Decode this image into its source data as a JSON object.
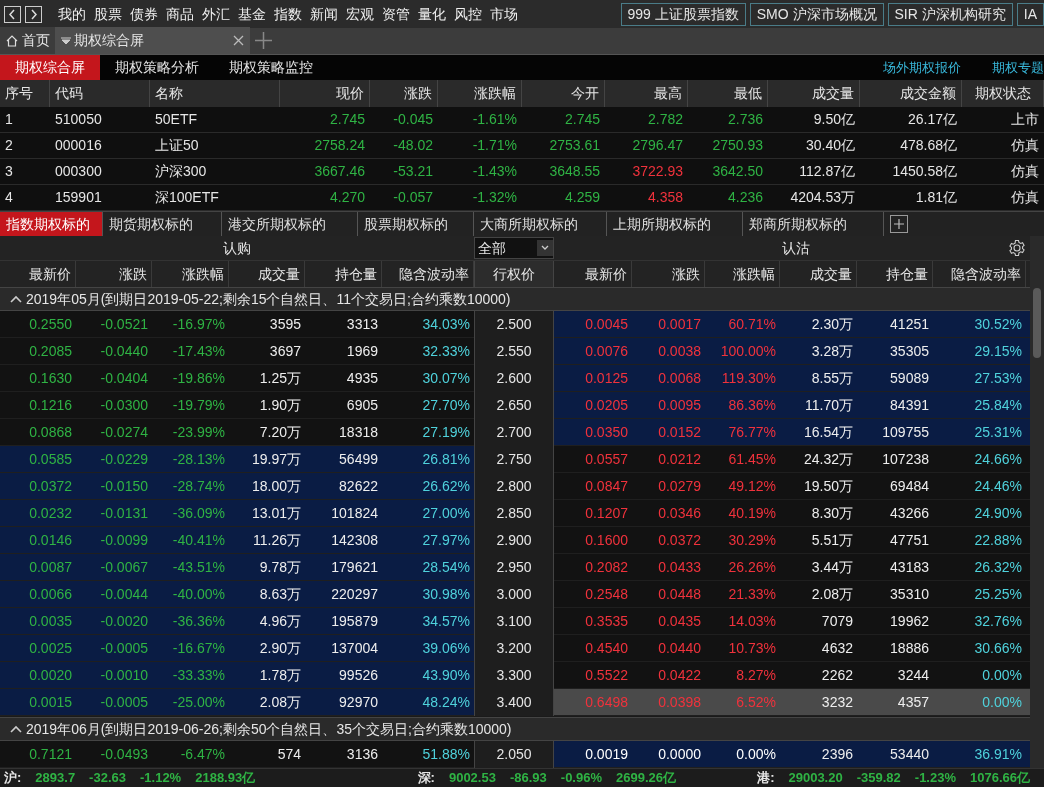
{
  "nav": {
    "items": [
      "我的",
      "股票",
      "债券",
      "商品",
      "外汇",
      "基金",
      "指数",
      "新闻",
      "宏观",
      "资管",
      "量化",
      "风控",
      "市场"
    ],
    "quick_links": [
      {
        "code": "999",
        "label": "上证股票指数"
      },
      {
        "code": "SMO",
        "label": "沪深市场概况"
      },
      {
        "code": "SIR",
        "label": "沪深机构研究"
      },
      {
        "code": "IA"
      }
    ]
  },
  "tabs": [
    {
      "label": "首页",
      "kind": "home",
      "selected": false
    },
    {
      "label": "期权综合屏",
      "kind": "page",
      "selected": true
    }
  ],
  "subnav": {
    "items": [
      {
        "label": "期权综合屏",
        "selected": true
      },
      {
        "label": "期权策略分析",
        "selected": false
      },
      {
        "label": "期权策略监控",
        "selected": false
      }
    ],
    "links": [
      "场外期权报价",
      "期权专题"
    ]
  },
  "underlying_table": {
    "columns": [
      "序号",
      "代码",
      "名称",
      "现价",
      "涨跌",
      "涨跌幅",
      "今开",
      "最高",
      "最低",
      "成交量",
      "成交金额",
      "期权状态"
    ],
    "rows": [
      {
        "cells": [
          {
            "text": "1"
          },
          {
            "text": "510050"
          },
          {
            "text": "50ETF"
          },
          {
            "text": "2.745",
            "color": "#2fb344"
          },
          {
            "text": "-0.045",
            "color": "#2fb344"
          },
          {
            "text": "-1.61%",
            "color": "#2fb344"
          },
          {
            "text": "2.745",
            "color": "#2fb344"
          },
          {
            "text": "2.782",
            "color": "#2fb344"
          },
          {
            "text": "2.736",
            "color": "#2fb344"
          },
          {
            "text": "9.50亿"
          },
          {
            "text": "26.17亿"
          },
          {
            "text": "上市"
          }
        ]
      },
      {
        "cells": [
          {
            "text": "2"
          },
          {
            "text": "000016"
          },
          {
            "text": "上证50"
          },
          {
            "text": "2758.24",
            "color": "#2fb344"
          },
          {
            "text": "-48.02",
            "color": "#2fb344"
          },
          {
            "text": "-1.71%",
            "color": "#2fb344"
          },
          {
            "text": "2753.61",
            "color": "#2fb344"
          },
          {
            "text": "2796.47",
            "color": "#2fb344"
          },
          {
            "text": "2750.93",
            "color": "#2fb344"
          },
          {
            "text": "30.40亿"
          },
          {
            "text": "478.68亿"
          },
          {
            "text": "仿真"
          }
        ]
      },
      {
        "cells": [
          {
            "text": "3"
          },
          {
            "text": "000300"
          },
          {
            "text": "沪深300"
          },
          {
            "text": "3667.46",
            "color": "#2fb344"
          },
          {
            "text": "-53.21",
            "color": "#2fb344"
          },
          {
            "text": "-1.43%",
            "color": "#2fb344"
          },
          {
            "text": "3648.55",
            "color": "#2fb344"
          },
          {
            "text": "3722.93",
            "color": "#f0323c"
          },
          {
            "text": "3642.50",
            "color": "#2fb344"
          },
          {
            "text": "112.87亿"
          },
          {
            "text": "1450.58亿"
          },
          {
            "text": "仿真"
          }
        ]
      },
      {
        "cells": [
          {
            "text": "4"
          },
          {
            "text": "159901"
          },
          {
            "text": "深100ETF"
          },
          {
            "text": "4.270",
            "color": "#2fb344"
          },
          {
            "text": "-0.057",
            "color": "#2fb344"
          },
          {
            "text": "-1.32%",
            "color": "#2fb344"
          },
          {
            "text": "4.259",
            "color": "#2fb344"
          },
          {
            "text": "4.358",
            "color": "#f0323c"
          },
          {
            "text": "4.236",
            "color": "#2fb344"
          },
          {
            "text": "4204.53万"
          },
          {
            "text": "1.81亿"
          },
          {
            "text": "仿真"
          }
        ]
      }
    ]
  },
  "category_tabs": [
    {
      "label": "指数期权标的",
      "selected": true
    },
    {
      "label": "期货期权标的",
      "selected": false
    },
    {
      "label": "港交所期权标的",
      "selected": false
    },
    {
      "label": "股票期权标的",
      "selected": false
    },
    {
      "label": "大商所期权标的",
      "selected": false
    },
    {
      "label": "上期所期权标的",
      "selected": false
    },
    {
      "label": "郑商所期权标的",
      "selected": false
    }
  ],
  "options": {
    "call_title": "认购",
    "put_title": "认沽",
    "filter": "全部",
    "call_columns": [
      "最新价",
      "涨跌",
      "涨跌幅",
      "成交量",
      "持仓量",
      "隐含波动率"
    ],
    "strike_column": "行权价",
    "put_columns": [
      "最新价",
      "涨跌",
      "涨跌幅",
      "成交量",
      "持仓量",
      "隐含波动率"
    ],
    "groups": [
      {
        "title": "2019年05月(到期日2019-05-22;剩余15个自然日、11个交易日;合约乘数10000)",
        "expanded": true,
        "rows": [
          {
            "strike": "2.500",
            "call_in_money": true,
            "selected": false,
            "call": {
              "color": "#2fb344",
              "cells": [
                "0.2550",
                "-0.0521",
                "-16.97%",
                "3595",
                "3313",
                "34.03%"
              ]
            },
            "put": {
              "color": "#f0323c",
              "cells": [
                "0.0045",
                "0.0017",
                "60.71%",
                "2.30万",
                "41251",
                "30.52%"
              ]
            }
          },
          {
            "strike": "2.550",
            "call_in_money": true,
            "selected": false,
            "call": {
              "color": "#2fb344",
              "cells": [
                "0.2085",
                "-0.0440",
                "-17.43%",
                "3697",
                "1969",
                "32.33%"
              ]
            },
            "put": {
              "color": "#f0323c",
              "cells": [
                "0.0076",
                "0.0038",
                "100.00%",
                "3.28万",
                "35305",
                "29.15%"
              ]
            }
          },
          {
            "strike": "2.600",
            "call_in_money": true,
            "selected": false,
            "call": {
              "color": "#2fb344",
              "cells": [
                "0.1630",
                "-0.0404",
                "-19.86%",
                "1.25万",
                "4935",
                "30.07%"
              ]
            },
            "put": {
              "color": "#f0323c",
              "cells": [
                "0.0125",
                "0.0068",
                "119.30%",
                "8.55万",
                "59089",
                "27.53%"
              ]
            }
          },
          {
            "strike": "2.650",
            "call_in_money": true,
            "selected": false,
            "call": {
              "color": "#2fb344",
              "cells": [
                "0.1216",
                "-0.0300",
                "-19.79%",
                "1.90万",
                "6905",
                "27.70%"
              ]
            },
            "put": {
              "color": "#f0323c",
              "cells": [
                "0.0205",
                "0.0095",
                "86.36%",
                "11.70万",
                "84391",
                "25.84%"
              ]
            }
          },
          {
            "strike": "2.700",
            "call_in_money": true,
            "selected": false,
            "call": {
              "color": "#2fb344",
              "cells": [
                "0.0868",
                "-0.0274",
                "-23.99%",
                "7.20万",
                "18318",
                "27.19%"
              ]
            },
            "put": {
              "color": "#f0323c",
              "cells": [
                "0.0350",
                "0.0152",
                "76.77%",
                "16.54万",
                "109755",
                "25.31%"
              ]
            }
          },
          {
            "strike": "2.750",
            "call_in_money": false,
            "selected": false,
            "call": {
              "color": "#2fb344",
              "cells": [
                "0.0585",
                "-0.0229",
                "-28.13%",
                "19.97万",
                "56499",
                "26.81%"
              ]
            },
            "put": {
              "color": "#f0323c",
              "cells": [
                "0.0557",
                "0.0212",
                "61.45%",
                "24.32万",
                "107238",
                "24.66%"
              ]
            }
          },
          {
            "strike": "2.800",
            "call_in_money": false,
            "selected": false,
            "call": {
              "color": "#2fb344",
              "cells": [
                "0.0372",
                "-0.0150",
                "-28.74%",
                "18.00万",
                "82622",
                "26.62%"
              ]
            },
            "put": {
              "color": "#f0323c",
              "cells": [
                "0.0847",
                "0.0279",
                "49.12%",
                "19.50万",
                "69484",
                "24.46%"
              ]
            }
          },
          {
            "strike": "2.850",
            "call_in_money": false,
            "selected": false,
            "call": {
              "color": "#2fb344",
              "cells": [
                "0.0232",
                "-0.0131",
                "-36.09%",
                "13.01万",
                "101824",
                "27.00%"
              ]
            },
            "put": {
              "color": "#f0323c",
              "cells": [
                "0.1207",
                "0.0346",
                "40.19%",
                "8.30万",
                "43266",
                "24.90%"
              ]
            }
          },
          {
            "strike": "2.900",
            "call_in_money": false,
            "selected": false,
            "call": {
              "color": "#2fb344",
              "cells": [
                "0.0146",
                "-0.0099",
                "-40.41%",
                "11.26万",
                "142308",
                "27.97%"
              ]
            },
            "put": {
              "color": "#f0323c",
              "cells": [
                "0.1600",
                "0.0372",
                "30.29%",
                "5.51万",
                "47751",
                "22.88%"
              ]
            }
          },
          {
            "strike": "2.950",
            "call_in_money": false,
            "selected": false,
            "call": {
              "color": "#2fb344",
              "cells": [
                "0.0087",
                "-0.0067",
                "-43.51%",
                "9.78万",
                "179621",
                "28.54%"
              ]
            },
            "put": {
              "color": "#f0323c",
              "cells": [
                "0.2082",
                "0.0433",
                "26.26%",
                "3.44万",
                "43183",
                "26.32%"
              ]
            }
          },
          {
            "strike": "3.000",
            "call_in_money": false,
            "selected": false,
            "call": {
              "color": "#2fb344",
              "cells": [
                "0.0066",
                "-0.0044",
                "-40.00%",
                "8.63万",
                "220297",
                "30.98%"
              ]
            },
            "put": {
              "color": "#f0323c",
              "cells": [
                "0.2548",
                "0.0448",
                "21.33%",
                "2.08万",
                "35310",
                "25.25%"
              ]
            }
          },
          {
            "strike": "3.100",
            "call_in_money": false,
            "selected": false,
            "call": {
              "color": "#2fb344",
              "cells": [
                "0.0035",
                "-0.0020",
                "-36.36%",
                "4.96万",
                "195879",
                "34.57%"
              ]
            },
            "put": {
              "color": "#f0323c",
              "cells": [
                "0.3535",
                "0.0435",
                "14.03%",
                "7079",
                "19962",
                "32.76%"
              ]
            }
          },
          {
            "strike": "3.200",
            "call_in_money": false,
            "selected": false,
            "call": {
              "color": "#2fb344",
              "cells": [
                "0.0025",
                "-0.0005",
                "-16.67%",
                "2.90万",
                "137004",
                "39.06%"
              ]
            },
            "put": {
              "color": "#f0323c",
              "cells": [
                "0.4540",
                "0.0440",
                "10.73%",
                "4632",
                "18886",
                "30.66%"
              ]
            }
          },
          {
            "strike": "3.300",
            "call_in_money": false,
            "selected": false,
            "call": {
              "color": "#2fb344",
              "cells": [
                "0.0020",
                "-0.0010",
                "-33.33%",
                "1.78万",
                "99526",
                "43.90%"
              ]
            },
            "put": {
              "color": "#f0323c",
              "cells": [
                "0.5522",
                "0.0422",
                "8.27%",
                "2262",
                "3244",
                "0.00%"
              ]
            }
          },
          {
            "strike": "3.400",
            "call_in_money": false,
            "selected": true,
            "call": {
              "color": "#2fb344",
              "cells": [
                "0.0015",
                "-0.0005",
                "-25.00%",
                "2.08万",
                "92970",
                "48.24%"
              ]
            },
            "put": {
              "color": "#f0323c",
              "cells": [
                "0.6498",
                "0.0398",
                "6.52%",
                "3232",
                "4357",
                "0.00%"
              ]
            }
          }
        ]
      },
      {
        "title": "2019年06月(到期日2019-06-26;剩余50个自然日、35个交易日;合约乘数10000)",
        "expanded": true,
        "rows": [
          {
            "strike": "2.050",
            "call_in_money": true,
            "selected": false,
            "call": {
              "color": "#2fb344",
              "cells": [
                "0.7121",
                "-0.0493",
                "-6.47%",
                "574",
                "3136",
                "51.88%"
              ]
            },
            "put": {
              "color": "#ffffff",
              "cells": [
                "0.0019",
                "0.0000",
                "0.00%",
                "2396",
                "53440",
                "36.91%"
              ]
            }
          }
        ]
      }
    ]
  },
  "status_bar": [
    {
      "market": "沪:",
      "index": "2893.7",
      "change": "-32.63",
      "pct": "-1.12%",
      "amount": "2188.93亿",
      "color": "#2fb344"
    },
    {
      "market": "深:",
      "index": "9002.53",
      "change": "-86.93",
      "pct": "-0.96%",
      "amount": "2699.26亿",
      "color": "#2fb344"
    },
    {
      "market": "港:",
      "index": "29003.20",
      "change": "-359.82",
      "pct": "-1.23%",
      "amount": "1076.66亿",
      "color": "#2fb344"
    }
  ]
}
